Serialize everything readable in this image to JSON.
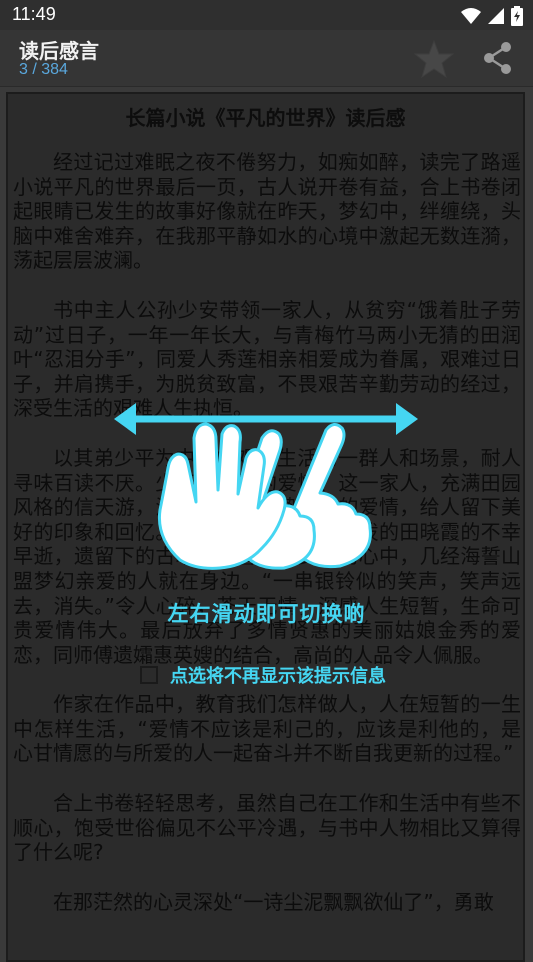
{
  "status_bar": {
    "time": "11:49"
  },
  "app_bar": {
    "title": "读后感言",
    "page_indicator": "3 / 384"
  },
  "article": {
    "title": "长篇小说《平凡的世界》读后感",
    "paragraphs": [
      "经过记过难眠之夜不倦努力，如痴如醉，读完了路遥小说平凡的世界最后一页，古人说开卷有益，合上书卷闭起眼睛已发生的故事好像就在昨天，梦幻中，绊缠绕，头脑中难舍难弃，在我那平静如水的心境中激起无数连漪，荡起层层波澜。",
      "书中主人公孙少安带领一家人，从贫穷“饿着肚子劳动”过日子，一年一年长大，与青梅竹马两小无猜的田润叶“忍泪分手”，同爱人秀莲相亲相爱成为眷属，艰难过日子，并肩携手，为脱贫致富，不畏艰苦辛勤劳动的经过，深受生活的艰难人生执恒。",
      "以其弟少平为中心的艰难生活的一群人和场景，耐人寻味百读不厌。少平与晓霞的爱情、这一家人，充满田园风格的信天游，活泼清新，诚挚浪漫的爱情，给人留下美好的印象和回忆。但是命运的不幸，活泼的田晓霞的不幸早逝，遗留下的古塔山的誓言在少平的心中，几经海誓山盟梦幻亲爱的人就在身边。“一串银铃似的笑声，笑声远去，消失。”令人心碎，苍天无情，深感人生短暂，生命可贵爱情伟大。最后放弃了多情贤惠的美丽姑娘金秀的爱恋，同师傅遗孀惠英嫂的结合，高尚的人品令人佩服。",
      "作家在作品中，教育我们怎样做人，人在短暂的一生中怎样生活，“爱情不应该是利己的，应该是利他的，是心甘情愿的与所爱的人一起奋斗并不断自我更新的过程。”",
      "合上书卷轻轻思考，虽然自己在工作和生活中有些不顺心，饱受世俗偏见不公平冷遇，与书中人物相比又算得了什么呢?",
      "在那茫然的心灵深处“一诗尘泥飘飘欲仙了”，勇敢"
    ]
  },
  "hint": {
    "main_text": "左右滑动即可切换啲",
    "checkbox_label": "点选将不再显示该提示信息"
  },
  "colors": {
    "accent": "#45d6f2",
    "subtitle": "#5aa8de"
  },
  "icons": [
    "wifi-icon",
    "signal-icon",
    "battery-icon",
    "star-icon",
    "share-icon"
  ]
}
